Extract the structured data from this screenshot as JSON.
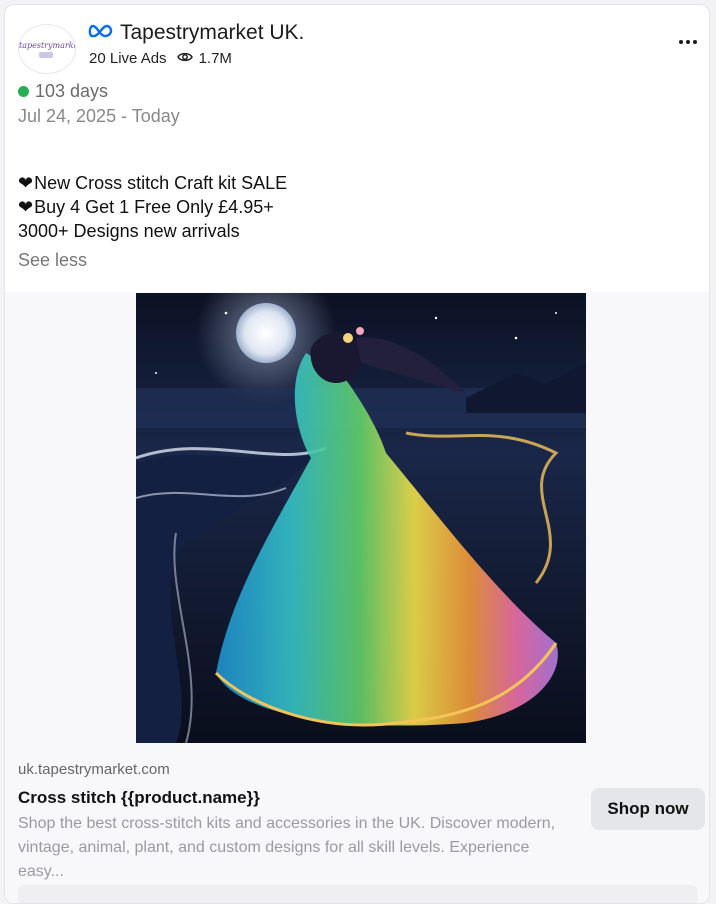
{
  "advertiser": {
    "avatar_text": "tapestrymarket",
    "name": "Tapestrymarket UK.",
    "live_ads": "20 Live Ads",
    "views": "1.7M"
  },
  "status": {
    "duration": "103 days",
    "date_range": "Jul 24, 2025 - Today",
    "active_color": "#27ae54"
  },
  "ad_copy": {
    "line1": "New Cross stitch Craft kit SALE",
    "line2": "Buy 4 Get 1 Free Only £4.95+",
    "line3": "3000+ Designs new arrivals",
    "heart_glyph": "❤",
    "toggle_label": "See less"
  },
  "creative": {
    "description_icon": "cross-stitch-rainbow-dress-woman-moonlit-beach"
  },
  "link": {
    "domain": "uk.tapestrymarket.com",
    "headline": "Cross stitch {{product.name}}",
    "description": "Shop the best cross-stitch kits and accessories in the UK. Discover modern, vintage, animal, plant, and custom designs for all skill levels. Experience easy...",
    "cta_label": "Shop now"
  },
  "icons": {
    "platform": "meta-icon",
    "views": "eye-icon",
    "menu": "more-options-icon"
  },
  "colors": {
    "meta_blue": "#0a6cf0",
    "cta_bg": "#e4e6ea"
  }
}
